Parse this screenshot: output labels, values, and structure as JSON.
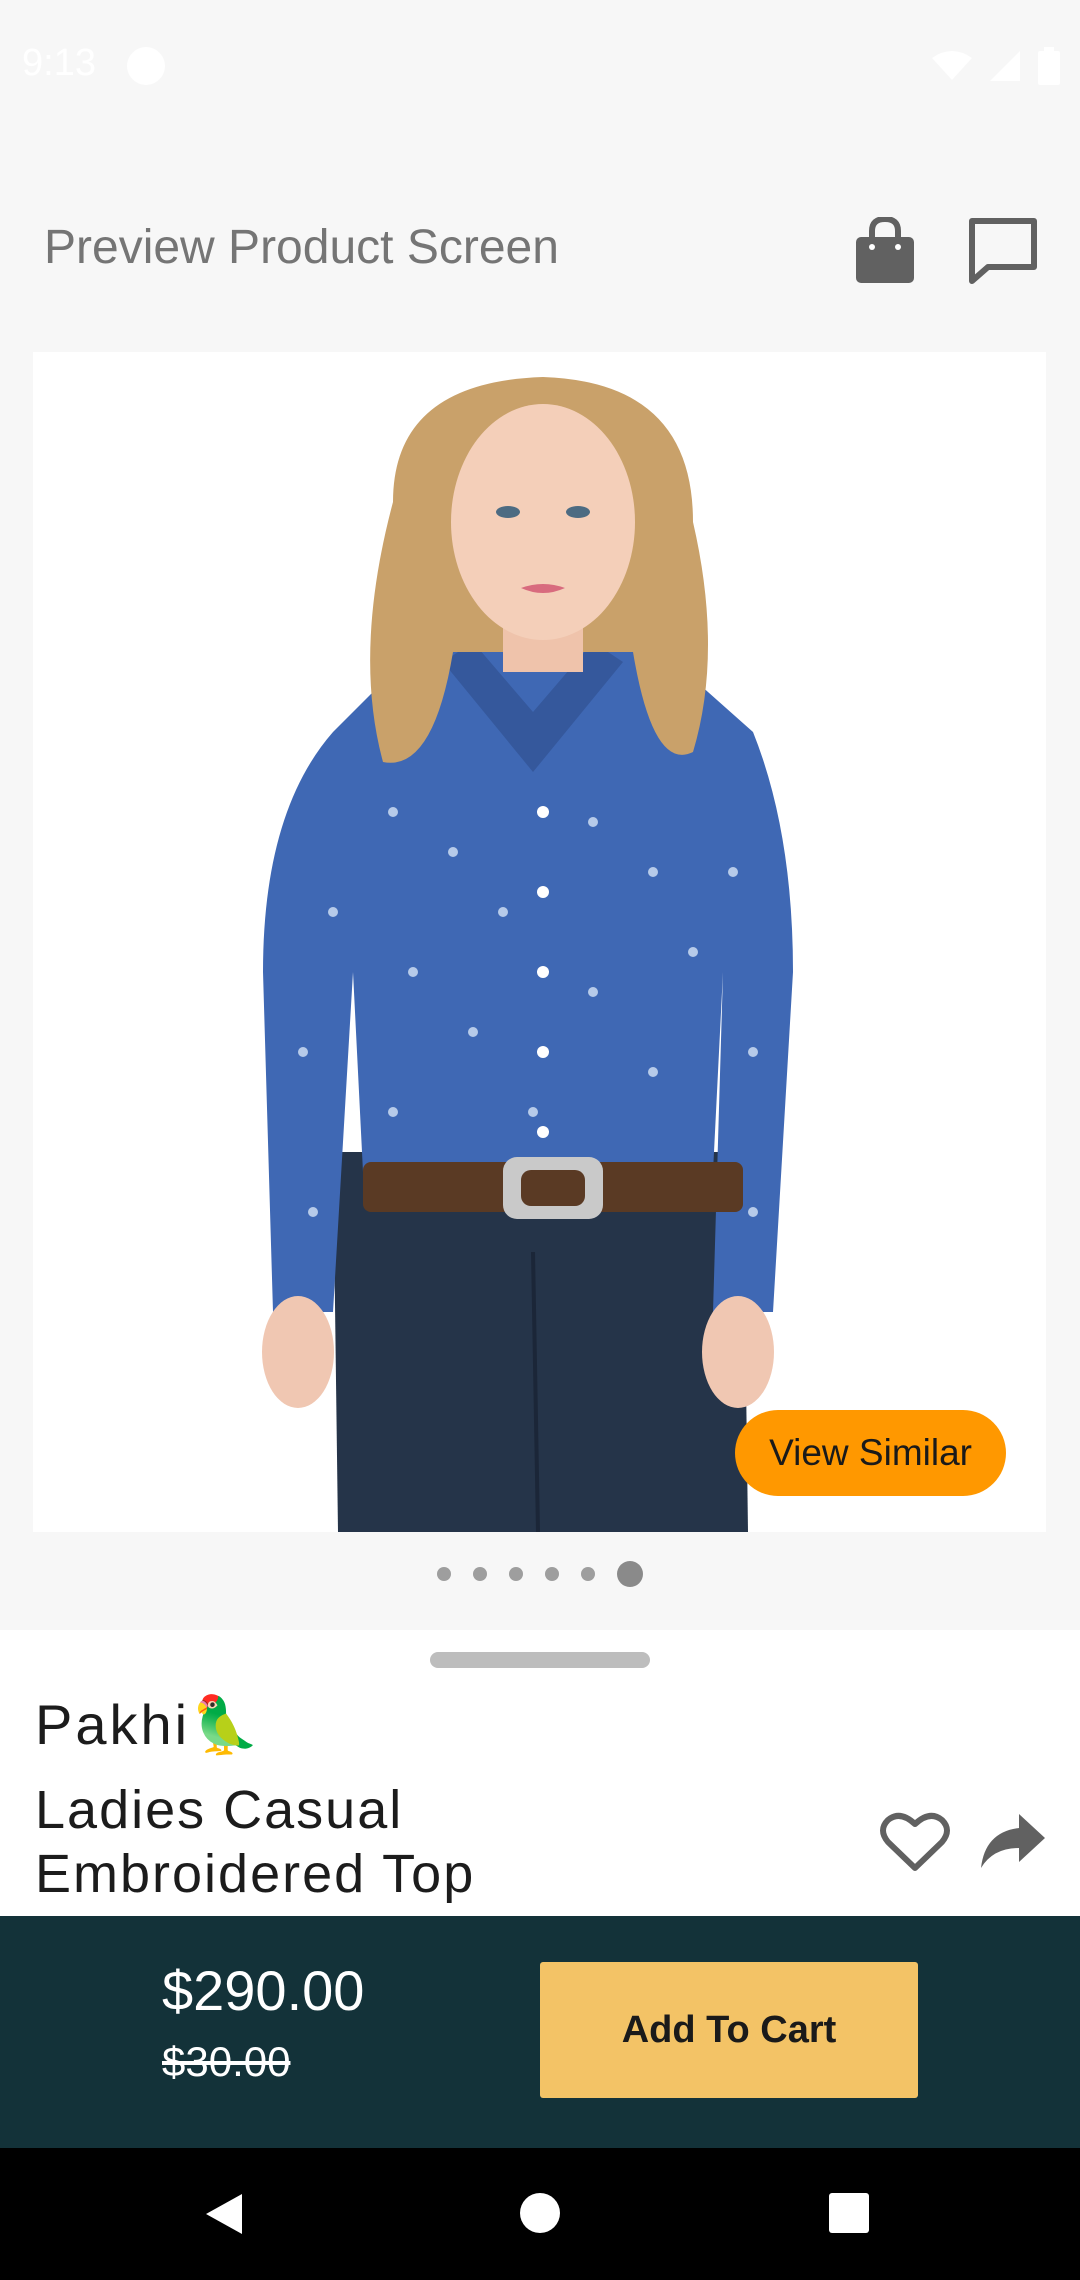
{
  "status_bar": {
    "time": "9:13"
  },
  "toolbar": {
    "title": "Preview Product Screen",
    "icons": [
      "shopping-bag-icon",
      "chat-icon"
    ]
  },
  "product_image": {
    "view_similar_label": "View Similar",
    "carousel": {
      "total": 6,
      "active_index": 5
    }
  },
  "product": {
    "brand": "Pakhi",
    "brand_emoji": "🦜",
    "name": "Ladies Casual Embroidered Top"
  },
  "cart_bar": {
    "price": "$290.00",
    "old_price": "$30.00",
    "add_to_cart_label": "Add To Cart"
  },
  "colors": {
    "accent_orange": "#ff9800",
    "cart_bar_bg": "#133239",
    "cart_button": "#f3c366"
  }
}
